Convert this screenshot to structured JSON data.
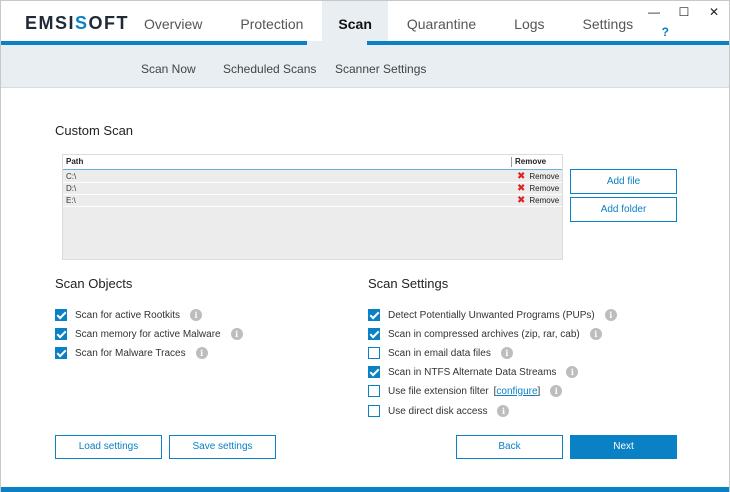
{
  "app": {
    "logo_left": "EMSI",
    "logo_x": "S",
    "logo_right": "OFT",
    "help": "?"
  },
  "window_controls": {
    "minimize": "—",
    "maximize": "☐",
    "close": "✕"
  },
  "nav": {
    "items": [
      "Overview",
      "Protection",
      "Scan",
      "Quarantine",
      "Logs",
      "Settings"
    ],
    "active": "Scan"
  },
  "subnav": {
    "items": [
      "Scan Now",
      "Scheduled Scans",
      "Scanner Settings"
    ],
    "active": "Scan Now"
  },
  "custom_scan": {
    "title": "Custom Scan",
    "col_path": "Path",
    "col_remove": "Remove",
    "rows": [
      {
        "path": "C:\\",
        "remove": "Remove"
      },
      {
        "path": "D:\\",
        "remove": "Remove"
      },
      {
        "path": "E:\\",
        "remove": "Remove"
      }
    ],
    "add_file": "Add file",
    "add_folder": "Add folder"
  },
  "scan_objects": {
    "title": "Scan Objects",
    "options": [
      {
        "label": "Scan for active Rootkits",
        "checked": true
      },
      {
        "label": "Scan memory for active Malware",
        "checked": true
      },
      {
        "label": "Scan for Malware Traces",
        "checked": true
      }
    ]
  },
  "scan_settings": {
    "title": "Scan Settings",
    "options": [
      {
        "label": "Detect Potentially Unwanted Programs (PUPs)",
        "checked": true
      },
      {
        "label": "Scan in compressed archives (zip, rar, cab)",
        "checked": true
      },
      {
        "label": "Scan in email data files",
        "checked": false
      },
      {
        "label": "Scan in NTFS Alternate Data Streams",
        "checked": true
      },
      {
        "label": "Use file extension filter",
        "checked": false,
        "link": "configure"
      },
      {
        "label": "Use direct disk access",
        "checked": false
      }
    ]
  },
  "footer": {
    "load": "Load settings",
    "save": "Save settings",
    "back": "Back",
    "next": "Next"
  },
  "colors": {
    "accent": "#0a81c4",
    "tab_active_bg": "#e8eef1"
  }
}
